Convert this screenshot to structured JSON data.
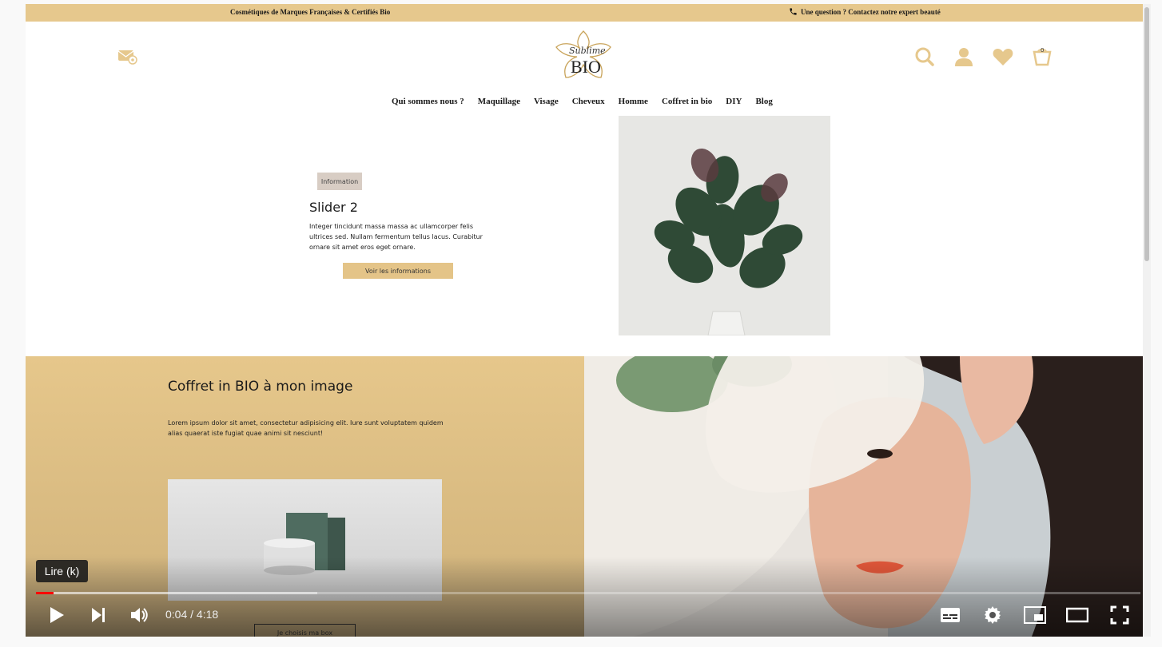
{
  "topbar": {
    "left_text": "Cosmétiques de Marques Françaises & Certifiés Bio",
    "right_text": "Une question ? Contactez notre expert beauté",
    "color": "#e6c88d"
  },
  "logo": {
    "script_text": "Sublime",
    "main_text": "BIO"
  },
  "header": {
    "cart_count": "0",
    "icons": [
      "mail-icon",
      "search-icon",
      "user-icon",
      "heart-icon",
      "cart-icon"
    ]
  },
  "nav": {
    "items": [
      "Qui sommes nous ?",
      "Maquillage",
      "Visage",
      "Cheveux",
      "Homme",
      "Coffret in bio",
      "DIY",
      "Blog"
    ]
  },
  "slider": {
    "badge": "Information",
    "title": "Slider 2",
    "text": "Integer tincidunt massa massa ac ullamcorper felis ultrices sed. Nullam fermentum tellus lacus. Curabitur ornare sit amet eros eget ornare.",
    "button": "Voir les informations"
  },
  "coffret": {
    "title": "Coffret in BIO à mon image",
    "text": "Lorem ipsum dolor sit amet, consectetur adipisicing elit. Iure sunt voluptatem quidem alias quaerat iste fugiat quae animi sit nesciunt!",
    "button": "Je choisis ma box",
    "accent": "#e6c78b"
  },
  "video": {
    "tooltip": "Lire (k)",
    "time": "0:04 / 4:18",
    "played_fraction": 0.016,
    "loaded_fraction": 0.255,
    "progress_color": "#ff0000"
  }
}
